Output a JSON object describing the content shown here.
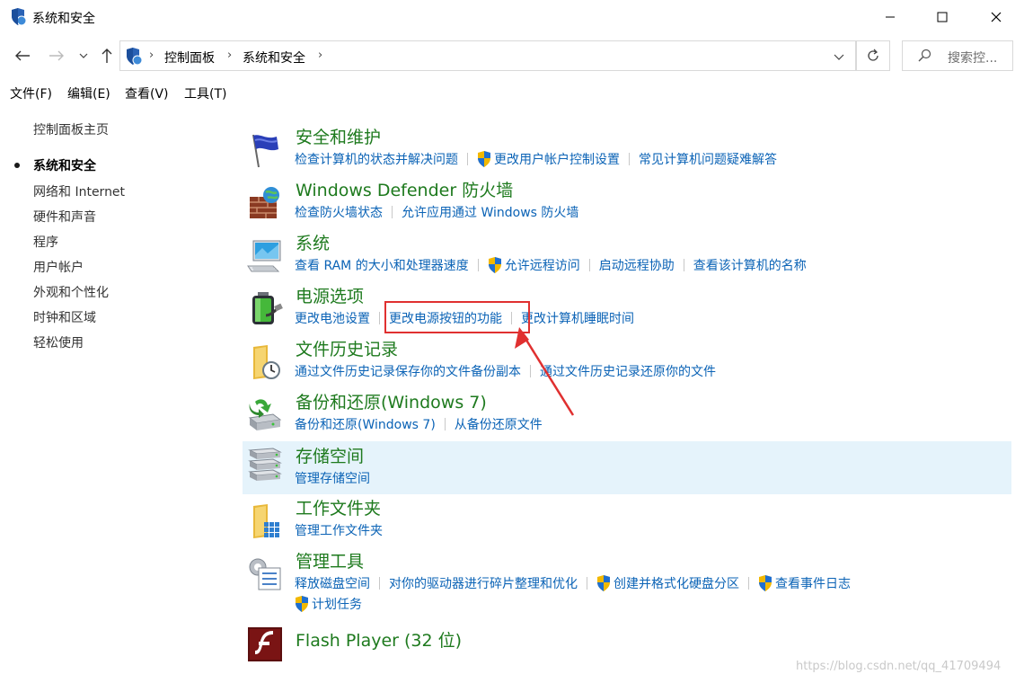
{
  "window": {
    "title": "系统和安全"
  },
  "nav": {
    "breadcrumb": [
      "控制面板",
      "系统和安全"
    ],
    "search_placeholder": "搜索控..."
  },
  "menu": [
    "文件(F)",
    "编辑(E)",
    "查看(V)",
    "工具(T)"
  ],
  "sidebar": {
    "home": "控制面板主页",
    "items": [
      {
        "label": "系统和安全",
        "active": true
      },
      {
        "label": "网络和 Internet"
      },
      {
        "label": "硬件和声音"
      },
      {
        "label": "程序"
      },
      {
        "label": "用户帐户"
      },
      {
        "label": "外观和个性化"
      },
      {
        "label": "时钟和区域"
      },
      {
        "label": "轻松使用"
      }
    ]
  },
  "categories": [
    {
      "title": "安全和维护",
      "icon": "flag-icon",
      "links": [
        {
          "label": "检查计算机的状态并解决问题"
        },
        {
          "label": "更改用户帐户控制设置",
          "shield": true
        },
        {
          "label": "常见计算机问题疑难解答"
        }
      ]
    },
    {
      "title": "Windows Defender 防火墙",
      "icon": "firewall-icon",
      "links": [
        {
          "label": "检查防火墙状态"
        },
        {
          "label": "允许应用通过 Windows 防火墙"
        }
      ]
    },
    {
      "title": "系统",
      "icon": "computer-icon",
      "links": [
        {
          "label": "查看 RAM 的大小和处理器速度"
        },
        {
          "label": "允许远程访问",
          "shield": true
        },
        {
          "label": "启动远程协助"
        },
        {
          "label": "查看该计算机的名称"
        }
      ]
    },
    {
      "title": "电源选项",
      "icon": "battery-icon",
      "links": [
        {
          "label": "更改电池设置"
        },
        {
          "label": "更改电源按钮的功能"
        },
        {
          "label": "更改计算机睡眠时间"
        }
      ]
    },
    {
      "title": "文件历史记录",
      "icon": "file-history-icon",
      "links": [
        {
          "label": "通过文件历史记录保存你的文件备份副本"
        },
        {
          "label": "通过文件历史记录还原你的文件"
        }
      ]
    },
    {
      "title": "备份和还原(Windows 7)",
      "icon": "backup-icon",
      "links": [
        {
          "label": "备份和还原(Windows 7)"
        },
        {
          "label": "从备份还原文件"
        }
      ]
    },
    {
      "title": "存储空间",
      "icon": "storage-icon",
      "hover": true,
      "links": [
        {
          "label": "管理存储空间"
        }
      ]
    },
    {
      "title": "工作文件夹",
      "icon": "work-folders-icon",
      "links": [
        {
          "label": "管理工作文件夹"
        }
      ]
    },
    {
      "title": "管理工具",
      "icon": "admin-tools-icon",
      "links": [
        {
          "label": "释放磁盘空间"
        },
        {
          "label": "对你的驱动器进行碎片整理和优化"
        },
        {
          "label": "创建并格式化硬盘分区",
          "shield": true
        },
        {
          "label": "查看事件日志",
          "shield": true
        }
      ],
      "links2": [
        {
          "label": "计划任务",
          "shield": true
        }
      ]
    },
    {
      "title": "Flash Player (32 位)",
      "icon": "flash-icon",
      "links": []
    }
  ],
  "watermark": "https://blog.csdn.net/qq_41709494"
}
